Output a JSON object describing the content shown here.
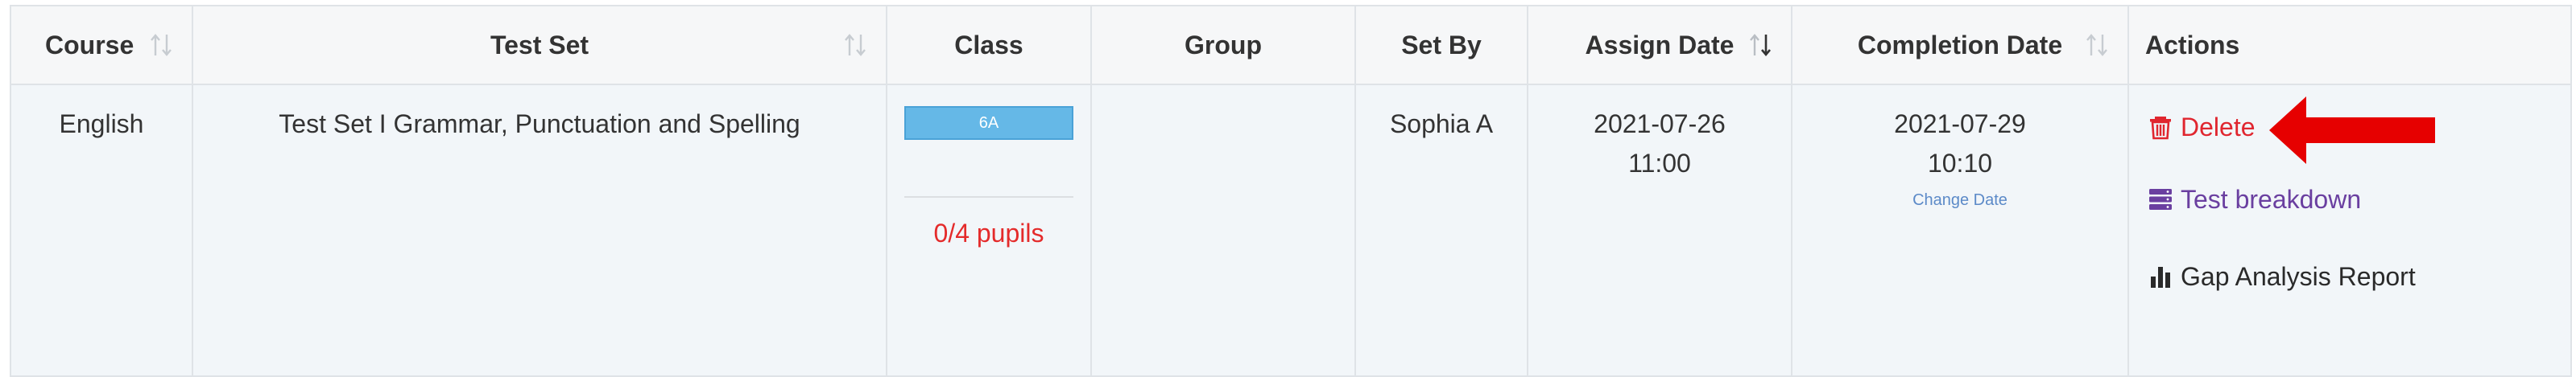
{
  "headers": {
    "course": "Course",
    "test_set": "Test Set",
    "class": "Class",
    "group": "Group",
    "set_by": "Set By",
    "assign_date": "Assign Date",
    "completion_date": "Completion Date",
    "actions": "Actions"
  },
  "row": {
    "course": "English",
    "test_set": "Test Set I Grammar, Punctuation and Spelling",
    "class_badge": "6A",
    "pupils": "0/4 pupils",
    "group": "",
    "set_by": "Sophia A",
    "assign_date": "2021-07-26",
    "assign_time": "11:00",
    "completion_date": "2021-07-29",
    "completion_time": "10:10",
    "change_date": "Change Date",
    "actions": {
      "delete": "Delete",
      "breakdown": "Test breakdown",
      "gap": "Gap Analysis Report"
    }
  },
  "icons": {
    "delete": "trash-icon",
    "breakdown": "server-stack-icon",
    "gap": "bar-chart-icon",
    "sort": "sort-arrows-icon",
    "annotation": "red-arrow-icon"
  },
  "colors": {
    "delete": "#e0262f",
    "breakdown": "#6a3fa0",
    "badge": "#65b8e7",
    "pupils": "#e42b2b",
    "change_date": "#5c8ac8",
    "annotation_arrow": "#e60000"
  }
}
